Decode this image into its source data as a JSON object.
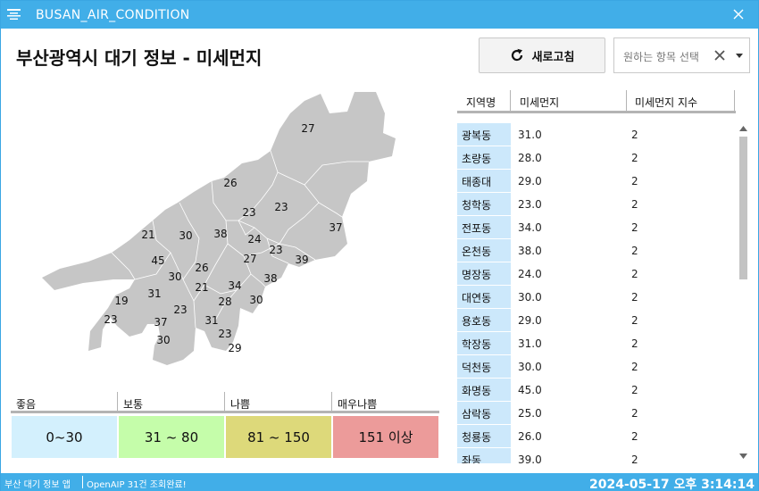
{
  "window": {
    "title": "BUSAN_AIR_CONDITION"
  },
  "header": {
    "title": "부산광역시 대기 정보 -   미세먼지",
    "refresh_label": "새로고침",
    "select_placeholder": "원하는 항목 선택"
  },
  "map": {
    "fill_color": "#c6c6c6",
    "labels": [
      "27",
      "26",
      "23",
      "23",
      "37",
      "21",
      "30",
      "38",
      "24",
      "23",
      "39",
      "45",
      "27",
      "26",
      "30",
      "38",
      "21",
      "34",
      "31",
      "28",
      "30",
      "19",
      "23",
      "23",
      "37",
      "31",
      "30",
      "23",
      "29"
    ]
  },
  "legend": {
    "headers": [
      "좋음",
      "보통",
      "나쁨",
      "매우나쁨"
    ],
    "ranges": [
      "0~30",
      "31 ~ 80",
      "81 ~ 150",
      "151 이상"
    ],
    "colors": [
      "#d3f0fd",
      "#c5fdaa",
      "#ddd97a",
      "#ec9b9a"
    ]
  },
  "table": {
    "headers": [
      "지역명",
      "미세먼지",
      "미세먼지 지수"
    ],
    "rows": [
      [
        "광복동",
        "31.0",
        "2"
      ],
      [
        "초량동",
        "28.0",
        "2"
      ],
      [
        "태종대",
        "29.0",
        "2"
      ],
      [
        "청학동",
        "23.0",
        "2"
      ],
      [
        "전포동",
        "34.0",
        "2"
      ],
      [
        "온천동",
        "38.0",
        "2"
      ],
      [
        "명장동",
        "24.0",
        "2"
      ],
      [
        "대연동",
        "30.0",
        "2"
      ],
      [
        "용호동",
        "29.0",
        "2"
      ],
      [
        "학장동",
        "31.0",
        "2"
      ],
      [
        "덕천동",
        "30.0",
        "2"
      ],
      [
        "화명동",
        "45.0",
        "2"
      ],
      [
        "삼락동",
        "25.0",
        "2"
      ],
      [
        "청룡동",
        "26.0",
        "2"
      ],
      [
        "좌동",
        "39.0",
        "2"
      ]
    ]
  },
  "status": {
    "app_name": "부산 대기 정보 앱",
    "message": "OpenAIP 31건 조회완료!",
    "clock": "2024-05-17 오후 3:14:14"
  },
  "colors": {
    "accent": "#41aee8",
    "row_label_bg": "#cce8fb"
  }
}
